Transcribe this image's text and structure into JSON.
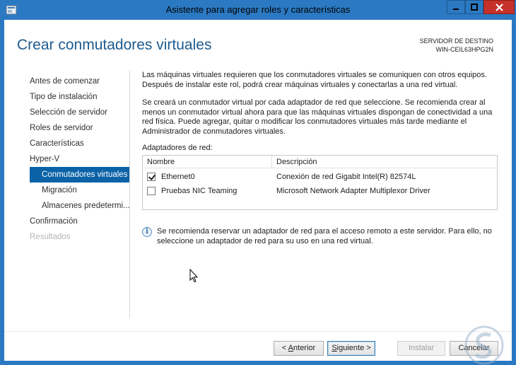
{
  "window": {
    "title": "Asistente para agregar roles y características"
  },
  "header": {
    "page_title": "Crear conmutadores virtuales",
    "dest_label": "SERVIDOR DE DESTINO",
    "dest_server": "WIN-CEIL63HPG2N"
  },
  "nav": {
    "items": [
      {
        "label": "Antes de comenzar",
        "state": "normal"
      },
      {
        "label": "Tipo de instalación",
        "state": "normal"
      },
      {
        "label": "Selección de servidor",
        "state": "normal"
      },
      {
        "label": "Roles de servidor",
        "state": "normal"
      },
      {
        "label": "Características",
        "state": "normal"
      },
      {
        "label": "Hyper-V",
        "state": "normal"
      },
      {
        "label": "Conmutadores virtuales",
        "state": "active"
      },
      {
        "label": "Migración",
        "state": "sub"
      },
      {
        "label": "Almacenes predetermi...",
        "state": "sub"
      },
      {
        "label": "Confirmación",
        "state": "normal"
      },
      {
        "label": "Resultados",
        "state": "disabled"
      }
    ]
  },
  "content": {
    "para1": "Las máquinas virtuales requieren que los conmutadores virtuales se comuniquen con otros equipos. Después de instalar este rol, podrá crear máquinas virtuales y conectarlas a una red virtual.",
    "para2": "Se creará un conmutador virtual por cada adaptador de red que seleccione. Se recomienda crear al menos un conmutador virtual ahora para que las máquinas virtuales dispongan de conectividad a una red física. Puede agregar, quitar o modificar los conmutadores virtuales más tarde mediante el Administrador de conmutadores virtuales.",
    "adapters_label": "Adaptadores de red:",
    "table": {
      "col_name": "Nombre",
      "col_desc": "Descripción",
      "rows": [
        {
          "name": "Ethernet0",
          "desc": "Conexión de red Gigabit Intel(R) 82574L",
          "checked": true
        },
        {
          "name": "Pruebas NIC Teaming",
          "desc": "Microsoft Network Adapter Multiplexor Driver",
          "checked": false
        }
      ]
    },
    "info": "Se recomienda reservar un adaptador de red para el acceso remoto a este servidor. Para ello, no seleccione un adaptador de red para su uso en una red virtual."
  },
  "footer": {
    "prev_prefix": "< ",
    "prev_key": "A",
    "prev_rest": "nterior",
    "next_key": "S",
    "next_rest": "iguiente >",
    "install_label": "Instalar",
    "cancel_label": "Cancelar"
  },
  "colors": {
    "title_bar": "#2b79c2",
    "accent": "#0b62a6",
    "heading": "#1d5b8f",
    "close_button": "#c7312b"
  }
}
